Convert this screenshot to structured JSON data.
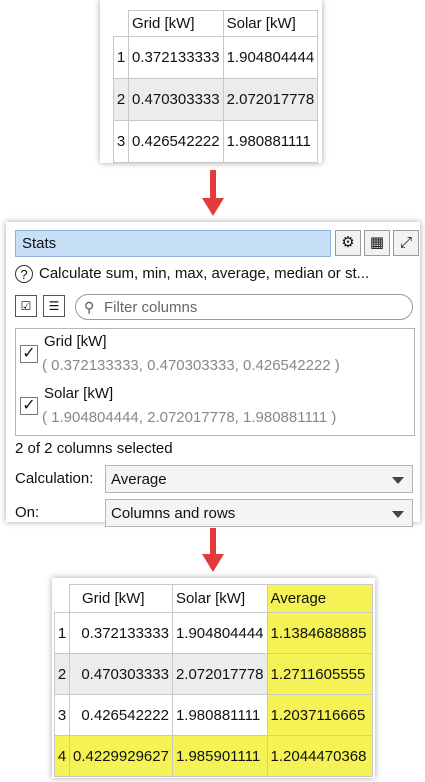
{
  "input_table": {
    "headers": [
      "Grid [kW]",
      "Solar [kW]"
    ],
    "rows": [
      {
        "n": "1",
        "grid": "0.372133333",
        "solar": "1.904804444"
      },
      {
        "n": "2",
        "grid": "0.470303333",
        "solar": "2.072017778"
      },
      {
        "n": "3",
        "grid": "0.426542222",
        "solar": "1.980881111"
      }
    ]
  },
  "stats_panel": {
    "title": "Stats",
    "description": "Calculate sum, min, max, average, median or st...",
    "filter_placeholder": "Filter columns",
    "columns": [
      {
        "name": "Grid [kW]",
        "values": "( 0.372133333, 0.470303333, 0.426542222 )",
        "checked": "✓"
      },
      {
        "name": "Solar [kW]",
        "values": "( 1.904804444, 2.072017778, 1.980881111 )",
        "checked": "✓"
      }
    ],
    "selected_count": "2 of 2 columns selected",
    "calculation_label": "Calculation:",
    "calculation_value": "Average",
    "on_label": "On:",
    "on_value": "Columns and rows"
  },
  "output_table": {
    "headers": [
      "Grid [kW]",
      "Solar [kW]",
      "Average"
    ],
    "rows": [
      {
        "n": "1",
        "grid": "0.372133333",
        "solar": "1.904804444",
        "avg": "1.1384688885"
      },
      {
        "n": "2",
        "grid": "0.470303333",
        "solar": "2.072017778",
        "avg": "1.2711605555"
      },
      {
        "n": "3",
        "grid": "0.426542222",
        "solar": "1.980881111",
        "avg": "1.2037116665"
      },
      {
        "n": "4",
        "grid": "0.4229929627",
        "solar": "1.985901111",
        "avg": "1.2044470368"
      }
    ]
  },
  "colors": {
    "arrow": "#e33b3b",
    "highlight": "#f4f255",
    "title_bar": "#c7dff7"
  },
  "icons": [
    "settings-icon",
    "table-icon",
    "expand-icon",
    "help-icon",
    "select-all-icon",
    "list-icon",
    "search-icon",
    "check-icon",
    "chevron-down-icon",
    "down-arrow-icon"
  ]
}
